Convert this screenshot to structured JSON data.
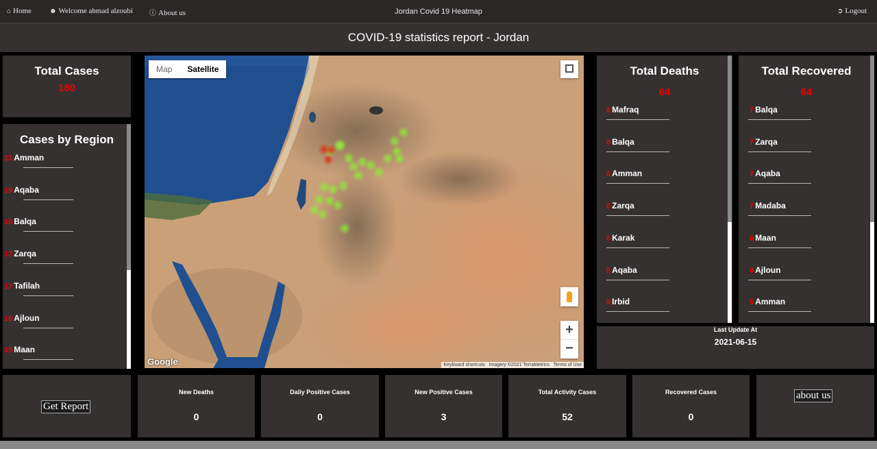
{
  "navbar": {
    "home": "Home",
    "welcome": "Welcome ahmad alzoubi",
    "about": "About us",
    "title": "Jordan Covid 19 Heatmap",
    "logout": "Logout"
  },
  "header": {
    "title": "COVID-19 statistics report - Jordan"
  },
  "total_cases": {
    "title": "Total Cases",
    "value": "180"
  },
  "cases_by_region": {
    "title": "Cases by Region",
    "items": [
      {
        "num": "21",
        "name": "Amman"
      },
      {
        "num": "19",
        "name": "Aqaba"
      },
      {
        "num": "18",
        "name": "Balqa"
      },
      {
        "num": "17",
        "name": "Zarqa"
      },
      {
        "num": "17",
        "name": "Tafilah"
      },
      {
        "num": "16",
        "name": "Ajloun"
      },
      {
        "num": "15",
        "name": "Maan"
      }
    ]
  },
  "total_deaths": {
    "title": "Total Deaths",
    "value": "64",
    "items": [
      {
        "num": "8",
        "name": "Mafraq"
      },
      {
        "num": "8",
        "name": "Balqa"
      },
      {
        "num": "6",
        "name": "Amman"
      },
      {
        "num": "6",
        "name": "Zarqa"
      },
      {
        "num": "6",
        "name": "Karak"
      },
      {
        "num": "5",
        "name": "Aqaba"
      },
      {
        "num": "5",
        "name": "Irbid"
      }
    ]
  },
  "total_recovered": {
    "title": "Total Recovered",
    "value": "64",
    "items": [
      {
        "num": "7",
        "name": "Balqa"
      },
      {
        "num": "7",
        "name": "Zarqa"
      },
      {
        "num": "7",
        "name": "Aqaba"
      },
      {
        "num": "7",
        "name": "Madaba"
      },
      {
        "num": "6",
        "name": "Maan"
      },
      {
        "num": "6",
        "name": "Ajloun"
      },
      {
        "num": "5",
        "name": "Amman"
      }
    ]
  },
  "last_update": {
    "label": "Last Update At",
    "date": "2021-06-15"
  },
  "map": {
    "map_label": "Map",
    "satellite_label": "Satellite",
    "selected": "Satellite",
    "google": "Google",
    "shortcuts": "Keyboard shortcuts",
    "imagery": "Imagery ©2021 TerraMetrics",
    "terms": "Terms of Use",
    "zoom_in": "+",
    "zoom_out": "−"
  },
  "bottom": {
    "get_report": "Get Report",
    "about_us": "about us",
    "stats": [
      {
        "label": "New Deaths",
        "value": "0"
      },
      {
        "label": "Daliy Positive Cases",
        "value": "0"
      },
      {
        "label": "New Positive Cases",
        "value": "3"
      },
      {
        "label": "Total Activity Cases",
        "value": "52"
      },
      {
        "label": "Recovered Cases",
        "value": "0"
      }
    ]
  },
  "icons": {
    "home": "home-icon",
    "user": "user-icon",
    "info": "info-icon",
    "logout": "logout-icon",
    "fullscreen": "fullscreen-icon",
    "pegman": "pegman-icon"
  },
  "colors": {
    "accent_red": "#e00000",
    "panel": "#353131",
    "heat_green": "#8fe83a",
    "heat_red": "#e0301e"
  }
}
